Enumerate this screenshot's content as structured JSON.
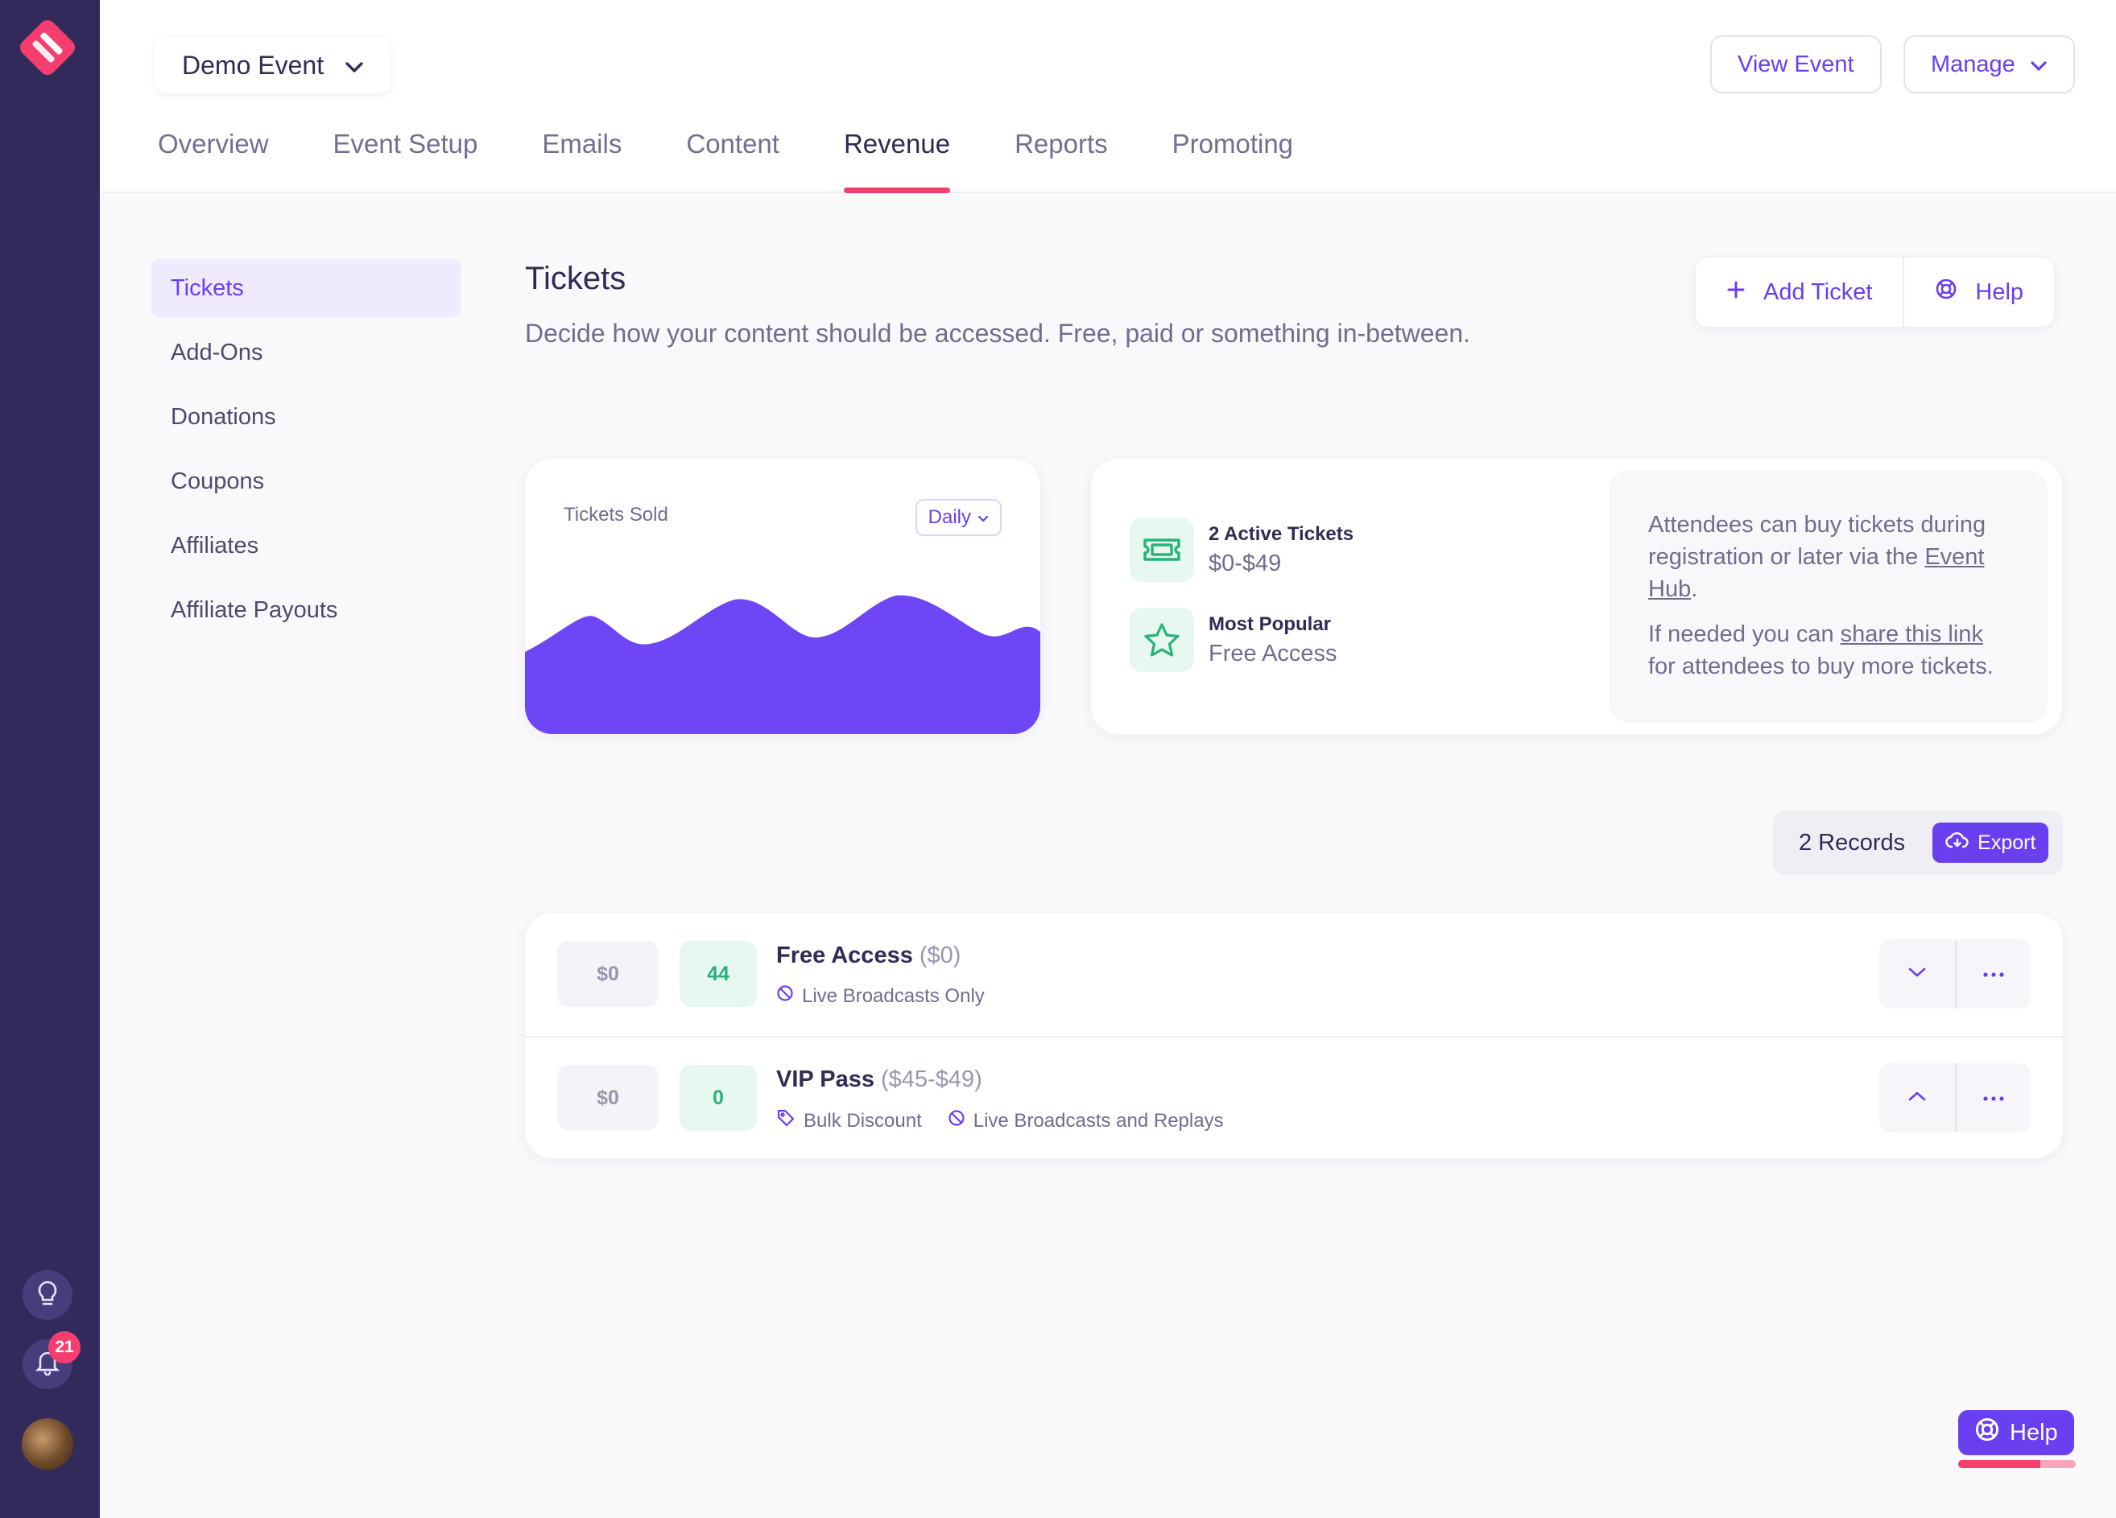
{
  "event_selector": {
    "label": "Demo Event"
  },
  "header_actions": {
    "view_event": "View Event",
    "manage": "Manage"
  },
  "tabs": [
    {
      "label": "Overview"
    },
    {
      "label": "Event Setup"
    },
    {
      "label": "Emails"
    },
    {
      "label": "Content"
    },
    {
      "label": "Revenue",
      "active": true
    },
    {
      "label": "Reports"
    },
    {
      "label": "Promoting"
    }
  ],
  "subnav": [
    {
      "label": "Tickets",
      "active": true
    },
    {
      "label": "Add-Ons"
    },
    {
      "label": "Donations"
    },
    {
      "label": "Coupons"
    },
    {
      "label": "Affiliates"
    },
    {
      "label": "Affiliate Payouts"
    }
  ],
  "page": {
    "title": "Tickets",
    "subtitle": "Decide how your content should be accessed. Free, paid or something in-between.",
    "add_ticket": "Add Ticket",
    "help": "Help"
  },
  "chart": {
    "title": "Tickets Sold",
    "period": "Daily",
    "color": "#6f46f5"
  },
  "stats": {
    "active_label": "2 Active Tickets",
    "active_value": "$0-$49",
    "popular_label": "Most Popular",
    "popular_value": "Free Access"
  },
  "info": {
    "p1_pre": "Attendees can buy tickets during registration or later via the ",
    "p1_link": "Event Hub",
    "p1_post": ".",
    "p2_pre": "If needed you can ",
    "p2_link": "share this link",
    "p2_post": " for attendees to buy more tickets."
  },
  "records": {
    "count": "2 Records",
    "export": "Export"
  },
  "tickets": [
    {
      "price": "$0",
      "sold": "44",
      "name": "Free Access",
      "price_range": "($0)",
      "tags": [
        "Live Broadcasts Only"
      ]
    },
    {
      "price": "$0",
      "sold": "0",
      "name": "VIP Pass",
      "price_range": "($45-$49)",
      "tags": [
        "Bulk Discount",
        "Live Broadcasts and Replays"
      ]
    }
  ],
  "rail": {
    "notification_count": "21"
  },
  "floating_help": {
    "label": "Help",
    "progress": 0.7
  },
  "colors": {
    "accent": "#6a3ff0",
    "brand_pink": "#f43f6e",
    "success": "#2ab27b",
    "rail": "#332a5c"
  }
}
